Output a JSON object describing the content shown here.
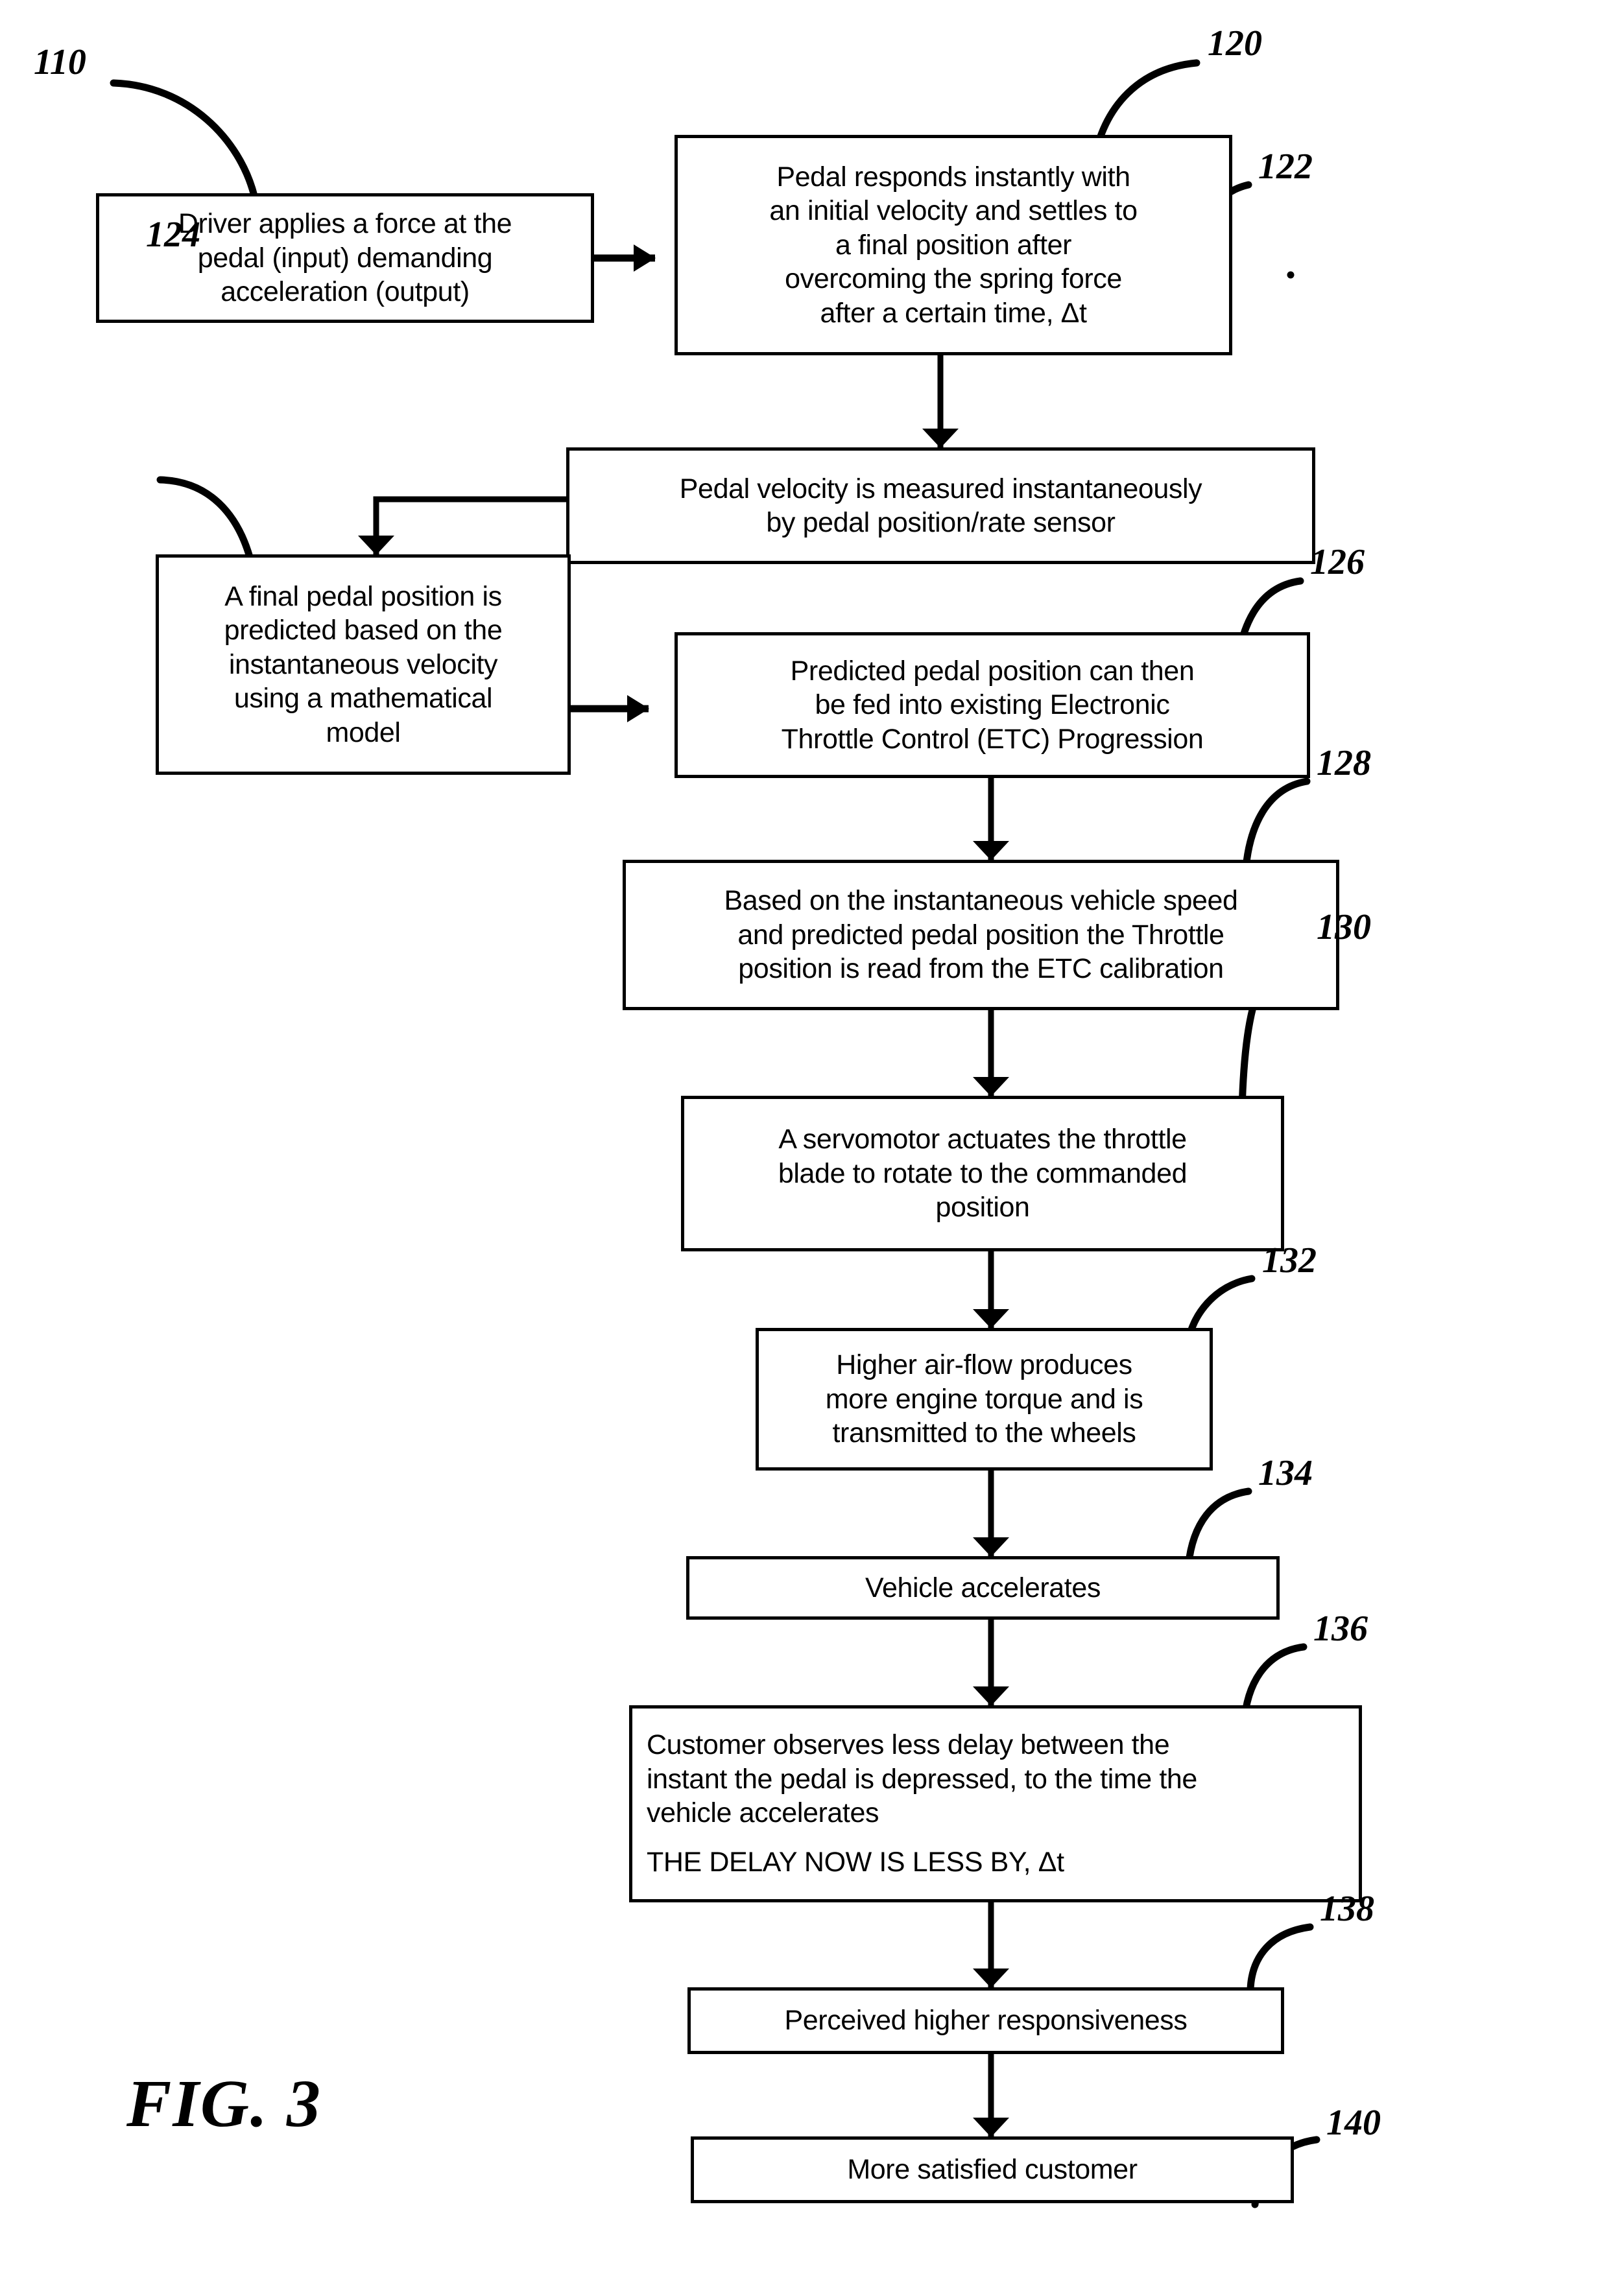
{
  "figure": {
    "label": "FIG. 3",
    "type": "flowchart"
  },
  "nodes": [
    {
      "id": "110",
      "ref": "110",
      "lines": [
        "Driver applies a force at the",
        "pedal (input) demanding",
        "acceleration (output)"
      ],
      "align": "center"
    },
    {
      "id": "120",
      "ref": "120",
      "lines": [
        "Pedal responds instantly with",
        "an initial velocity and settles to",
        "a final position after",
        "overcoming the spring force",
        "after a certain time, Δt"
      ],
      "align": "center"
    },
    {
      "id": "122",
      "ref": "122",
      "lines": [
        "Pedal velocity is measured instantaneously",
        "by pedal position/rate sensor"
      ],
      "align": "center"
    },
    {
      "id": "124",
      "ref": "124",
      "lines": [
        "A final pedal position is",
        "predicted based on the",
        "instantaneous velocity",
        "using a mathematical",
        "model"
      ],
      "align": "center"
    },
    {
      "id": "126",
      "ref": "126",
      "lines": [
        "Predicted pedal position can then",
        "be fed into existing Electronic",
        "Throttle Control (ETC) Progression"
      ],
      "align": "center"
    },
    {
      "id": "128",
      "ref": "128",
      "lines": [
        "Based on the instantaneous vehicle speed",
        "and predicted pedal position the Throttle",
        "position is read from the ETC calibration"
      ],
      "align": "center"
    },
    {
      "id": "130",
      "ref": "130",
      "lines": [
        "A servomotor actuates the throttle",
        "blade to rotate to the commanded",
        "position"
      ],
      "align": "center"
    },
    {
      "id": "132",
      "ref": "132",
      "lines": [
        "Higher air-flow produces",
        "more engine torque and is",
        "transmitted to the wheels"
      ],
      "align": "center"
    },
    {
      "id": "134",
      "ref": "134",
      "lines": [
        "Vehicle accelerates"
      ],
      "align": "center"
    },
    {
      "id": "136",
      "ref": "136",
      "lines": [
        "Customer observes less delay between the",
        "instant the pedal is depressed, to the time the",
        "vehicle accelerates",
        "",
        "THE DELAY NOW IS LESS BY, Δt"
      ],
      "align": "left"
    },
    {
      "id": "138",
      "ref": "138",
      "lines": [
        "Perceived  higher responsiveness"
      ],
      "align": "center"
    },
    {
      "id": "140",
      "ref": "140",
      "lines": [
        "More satisfied customer"
      ],
      "align": "center"
    }
  ],
  "colors": {
    "ink": "#000000",
    "paper": "#ffffff"
  }
}
